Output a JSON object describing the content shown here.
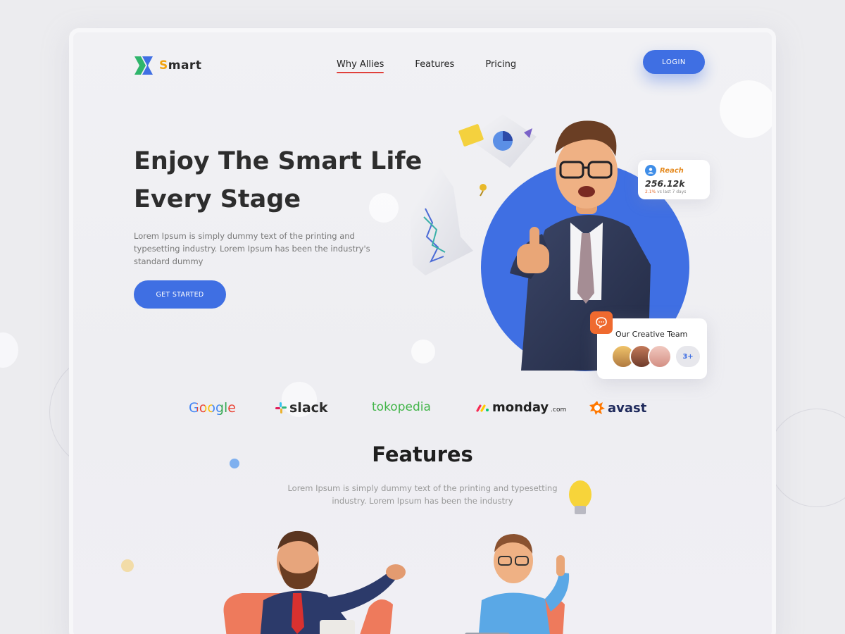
{
  "brand": {
    "logo_text_first": "S",
    "logo_text_rest": "mart",
    "accent": "#3f6fe3",
    "logo_green": "#2fb56b",
    "logo_orange": "#f2a30f"
  },
  "nav": {
    "items": [
      {
        "label": "Why Allies",
        "active": true
      },
      {
        "label": "Features",
        "active": false
      },
      {
        "label": "Pricing",
        "active": false
      }
    ],
    "login_label": "LOGIN"
  },
  "hero": {
    "title_line1": "Enjoy The Smart Life",
    "title_line2": "Every Stage",
    "description": "Lorem Ipsum is simply dummy text of the printing and typesetting industry. Lorem Ipsum has been the industry's standard dummy",
    "cta_label": "GET STARTED"
  },
  "reach_card": {
    "label": "Reach",
    "value": "256.12k",
    "change": "2.1%",
    "period": "vs last 7 days",
    "icon": "user-icon"
  },
  "team_card": {
    "title": "Our Creative Team",
    "more": "3+",
    "icon": "chat-icon"
  },
  "partners": {
    "google": "Google",
    "slack": "slack",
    "tokopedia": "tokopedia",
    "monday": "monday",
    "monday_suffix": ".com",
    "avast": "avast"
  },
  "features": {
    "title": "Features",
    "description": "Lorem Ipsum is simply dummy text of the printing and typesetting industry. Lorem Ipsum has been the industry"
  }
}
